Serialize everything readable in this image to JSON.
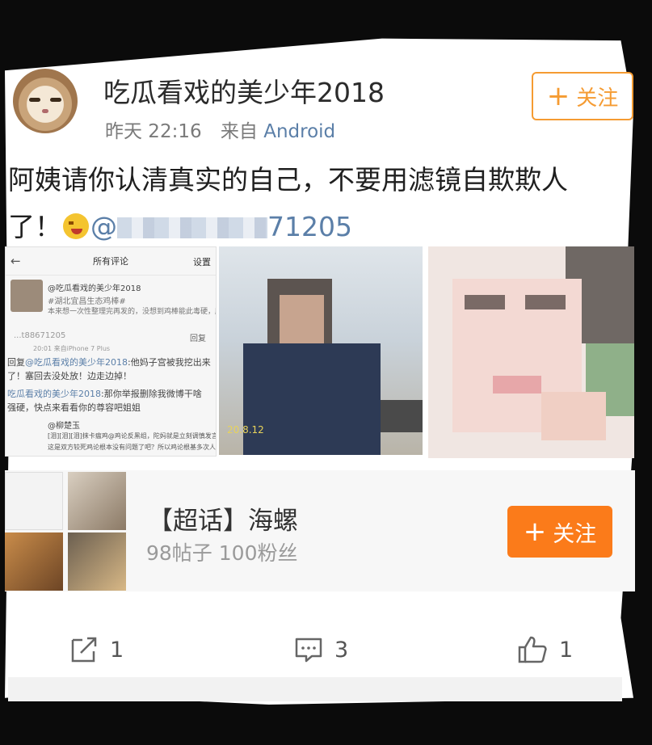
{
  "post": {
    "username": "吃瓜看戏的美少年2018",
    "time": "昨天 22:16",
    "source_prefix": "来自",
    "source_app": "Android",
    "follow_label": "关注",
    "text_line1": "阿姨请你认清真实的自己，不要用滤镜自欺欺人",
    "text_line2_prefix": "了！",
    "mention_prefix": "@",
    "mention_suffix": "71205"
  },
  "screenshot": {
    "title": "所有评论",
    "settings": "设置",
    "l1": "@吃瓜看戏的美少年2018",
    "l2": "#湖北宜昌生态鸡棒#",
    "l3": "本来想一次性整理完再发的，没想到鸡棒能此毒硬，所以先",
    "l4": "...t88671205",
    "l4b": "回复",
    "l5": "20:01 来自iPhone 7 Plus",
    "l6_prefix": "回复",
    "l6_mention": "@吃瓜看戏的美少年2018",
    "l6_rest": ":他妈子宫被我挖出来",
    "l7": "了！塞回去没处放！边走边掉！",
    "l8_mention": "吃瓜看戏的美少年2018",
    "l8_rest": ":那你举报删除我微博干啥",
    "l9": "强硬，快点来看看你的尊容吧姐姐",
    "l10": "@柳楚玉",
    "l11": "[泪][泪][泪]抹卡瘟鸡@鸡论反黑组，陀妈就是立刻调慎发言，",
    "l12": "这是双方较死鸡论根本没有问题了吧？所以鸡论根基多次人，"
  },
  "photo_stamp": "20.8.12",
  "topic": {
    "title": "【超话】海螺",
    "stats": "98帖子 100粉丝",
    "follow_label": "关注"
  },
  "actions": {
    "share_count": "1",
    "comment_count": "3",
    "like_count": "1"
  },
  "colors": {
    "accent_orange": "#fb7b1a",
    "link_blue": "#5b7fa8"
  },
  "icons": [
    "plus-icon",
    "share-icon",
    "comment-icon",
    "like-icon",
    "angry-emoji-icon",
    "back-arrow-icon"
  ]
}
